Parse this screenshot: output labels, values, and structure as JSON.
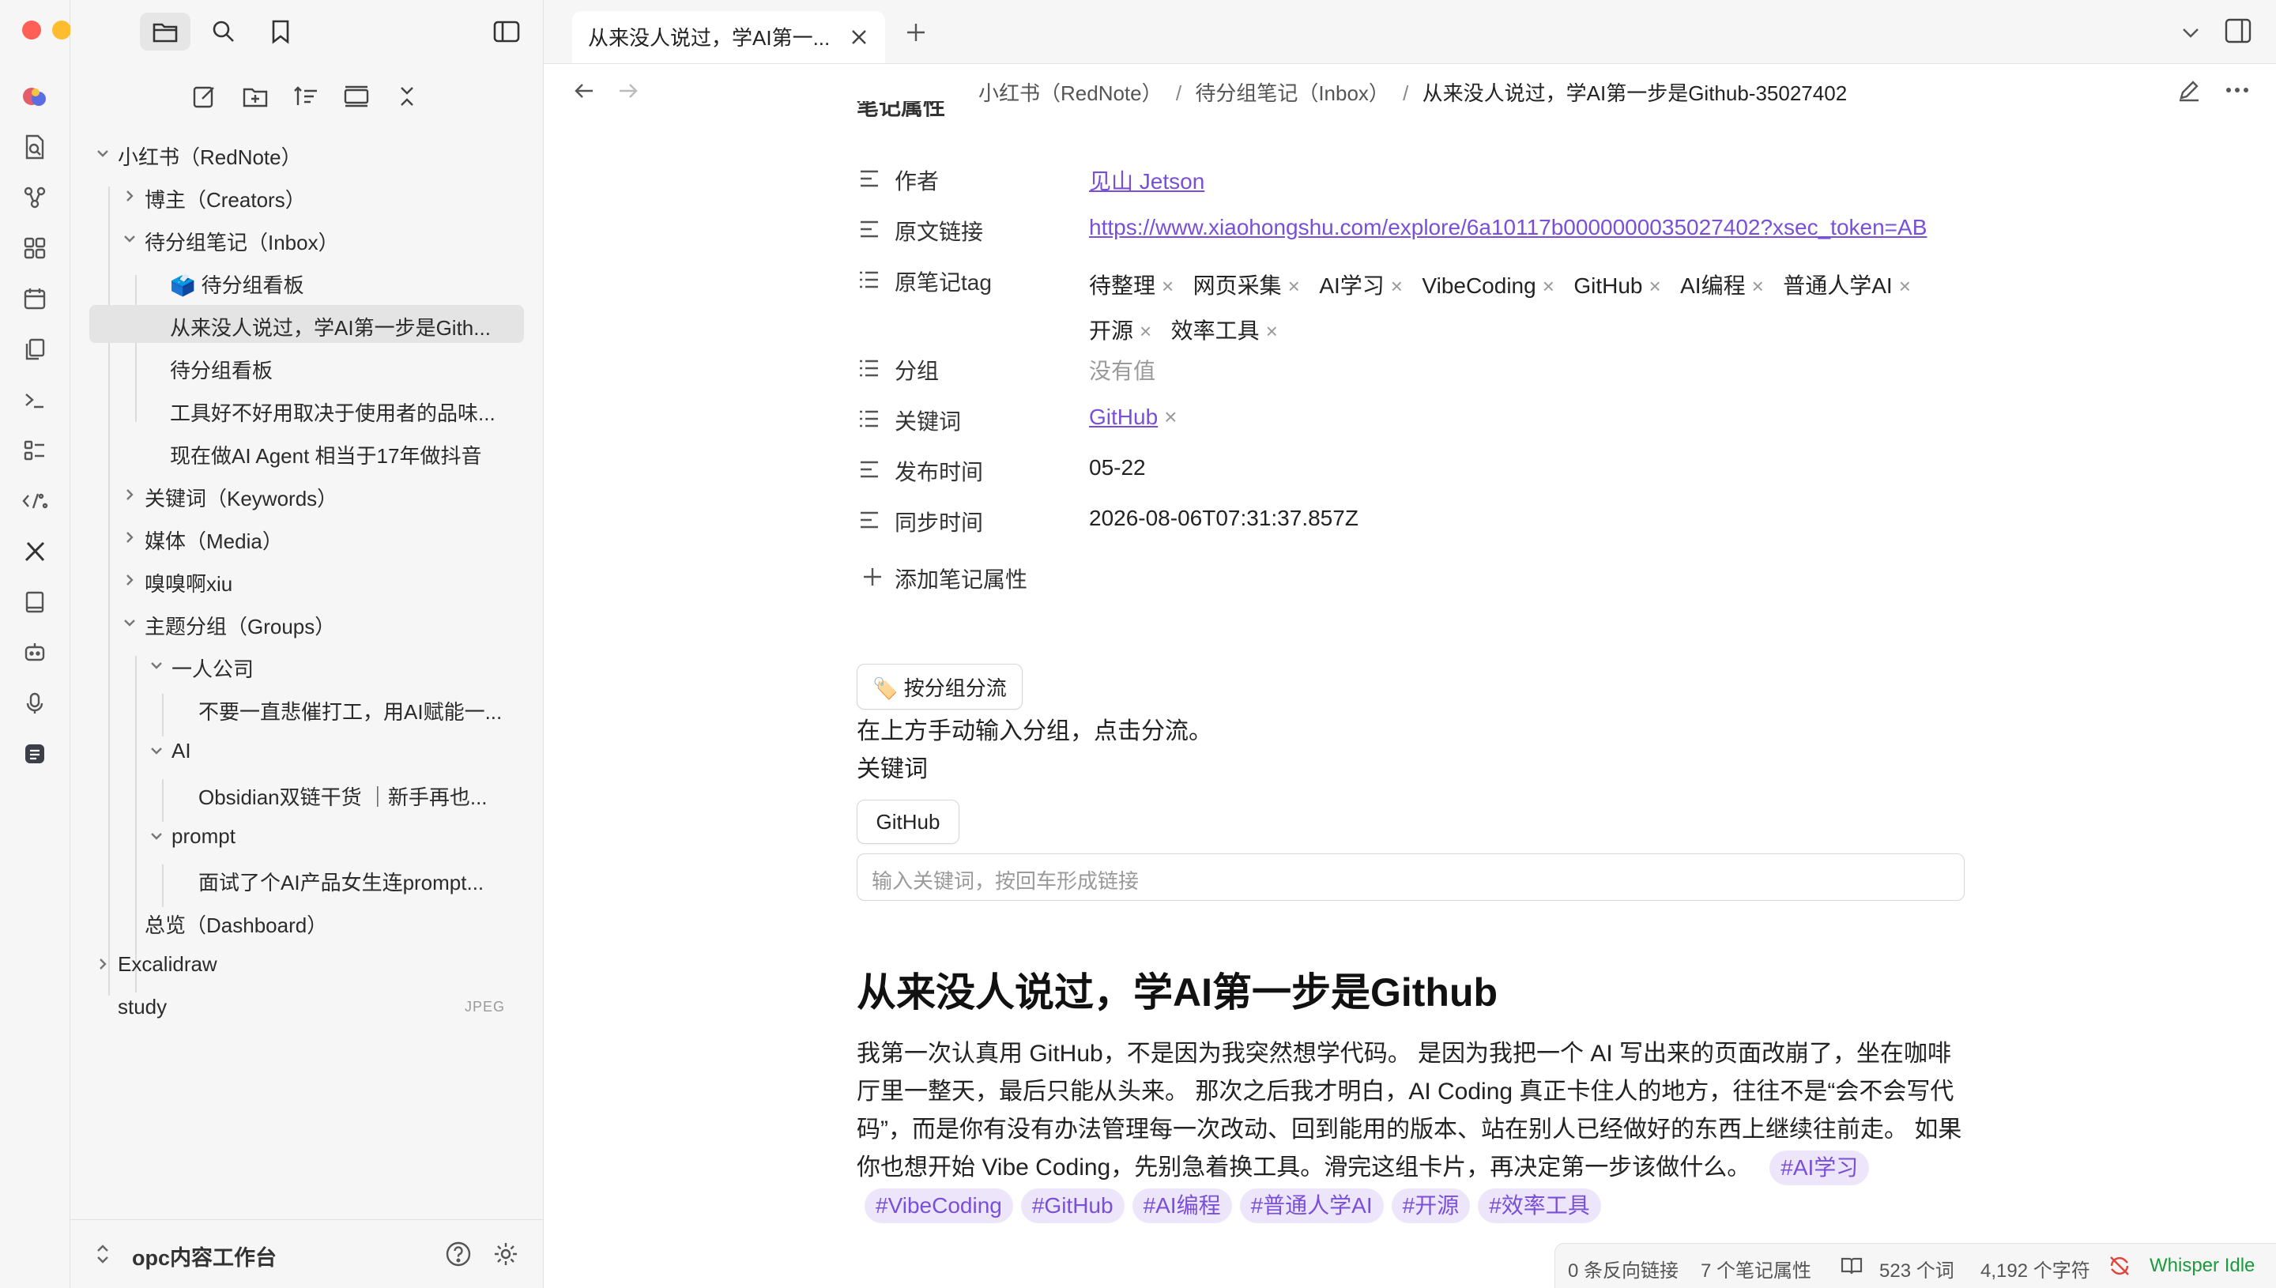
{
  "sidebar": {
    "tree": [
      {
        "label": "小红书（RedNote）"
      },
      {
        "label": "博主（Creators）"
      },
      {
        "label": "待分组笔记（Inbox）"
      },
      {
        "label": "🗳️ 待分组看板"
      },
      {
        "label": "从来没人说过，学AI第一步是Gith..."
      },
      {
        "label": "待分组看板"
      },
      {
        "label": "工具好不好用取决于使用者的品味..."
      },
      {
        "label": "现在做AI Agent 相当于17年做抖音"
      },
      {
        "label": "关键词（Keywords）"
      },
      {
        "label": "媒体（Media）"
      },
      {
        "label": "嗅嗅啊xiu"
      },
      {
        "label": "主题分组（Groups）"
      },
      {
        "label": "一人公司"
      },
      {
        "label": "不要一直悲催打工，用AI赋能一..."
      },
      {
        "label": "AI"
      },
      {
        "label": "Obsidian双链干货 ｜新手再也..."
      },
      {
        "label": "prompt"
      },
      {
        "label": "面试了个AI产品女生连prompt..."
      },
      {
        "label": "总览（Dashboard）"
      },
      {
        "label": "Excalidraw"
      },
      {
        "label": "study",
        "badge": "JPEG"
      }
    ],
    "vault_name": "opc内容工作台"
  },
  "tab": {
    "title": "从来没人说过，学AI第一..."
  },
  "breadcrumb": {
    "part1": "小红书（RedNote）",
    "part2": "待分组笔记（Inbox）",
    "part3": "从来没人说过，学AI第一步是Github-35027402",
    "sep": "/"
  },
  "properties": {
    "header_partial": "笔记属性",
    "author": {
      "name": "作者",
      "value": "见山 Jetson"
    },
    "source": {
      "name": "原文链接",
      "value": "https://www.xiaohongshu.com/explore/6a10117b0000000035027402?xsec_token=AB"
    },
    "tags": {
      "name": "原笔记tag",
      "values": [
        "待整理",
        "网页采集",
        "AI学习",
        "VibeCoding",
        "GitHub",
        "AI编程",
        "普通人学AI",
        "开源",
        "效率工具"
      ]
    },
    "group": {
      "name": "分组",
      "value": "没有值"
    },
    "keywords": {
      "name": "关键词",
      "value": "GitHub"
    },
    "publish": {
      "name": "发布时间",
      "value": "05-22"
    },
    "sync": {
      "name": "同步时间",
      "value": "2026-08-06T07:31:37.857Z"
    },
    "add_label": "添加笔记属性",
    "remove_glyph": "×"
  },
  "actions": {
    "route_button": "🏷️ 按分组分流",
    "route_hint": "在上方手动输入分组，点击分流。",
    "keywords_heading": "关键词",
    "keyword_chip": "GitHub",
    "keyword_placeholder": "输入关键词，按回车形成链接"
  },
  "note": {
    "heading": "从来没人说过，学AI第一步是Github",
    "paragraph": "我第一次认真用 GitHub，不是因为我突然想学代码。 是因为我把一个 AI 写出来的页面改崩了，坐在咖啡厅里一整天，最后只能从头来。 那次之后我才明白，AI Coding 真正卡住人的地方，往往不是“会不会写代码”，而是你有没有办法管理每一次改动、回到能用的版本、站在别人已经做好的东西上继续往前走。 如果你也想开始 Vibe Coding，先别急着换工具。滑完这组卡片，再决定第一步该做什么。",
    "hashtags": [
      "#AI学习",
      "#VibeCoding",
      "#GitHub",
      "#AI编程",
      "#普通人学AI",
      "#开源",
      "#效率工具"
    ]
  },
  "status": {
    "backlinks": "0 条反向链接",
    "props": "7 个笔记属性",
    "words": "523 个词",
    "chars": "4,192 个字符",
    "whisper": "Whisper Idle"
  },
  "colors": {
    "accent": "#7a4fd8",
    "tag_bg": "#ede6fb",
    "whisper": "#1a9c3c",
    "sync_icon": "#e0443a"
  }
}
